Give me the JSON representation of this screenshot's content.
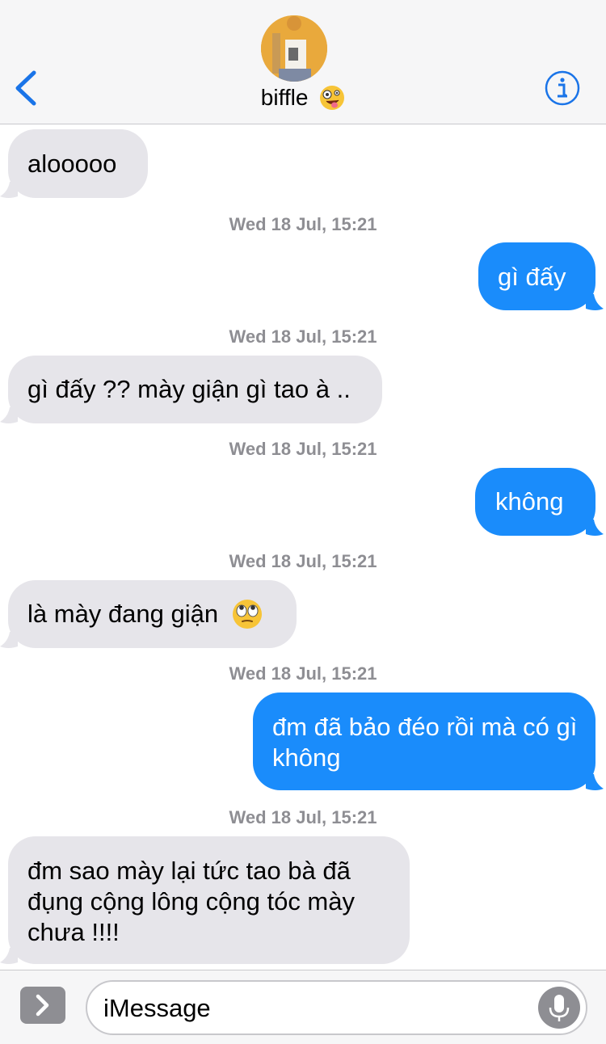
{
  "header": {
    "contact_name": "biffle",
    "back_icon": "chevron-left-icon",
    "info_icon": "info-icon",
    "accent": "#1a74e8"
  },
  "messages": [
    {
      "type": "incoming",
      "text": "alooooo"
    },
    {
      "type": "timestamp",
      "text": "Wed 18 Jul, 15:21"
    },
    {
      "type": "outgoing",
      "text": "gì đấy"
    },
    {
      "type": "timestamp",
      "text": "Wed 18 Jul, 15:21"
    },
    {
      "type": "incoming",
      "text": "gì đấy ?? mày giận gì tao à .."
    },
    {
      "type": "timestamp",
      "text": "Wed 18 Jul, 15:21"
    },
    {
      "type": "outgoing",
      "text": "không"
    },
    {
      "type": "timestamp",
      "text": "Wed 18 Jul, 15:21"
    },
    {
      "type": "incoming",
      "text": "là mày đang giận"
    },
    {
      "type": "timestamp",
      "text": "Wed 18 Jul, 15:21"
    },
    {
      "type": "outgoing",
      "text": "đm đã bảo đéo rồi mà có gì không"
    },
    {
      "type": "timestamp",
      "text": "Wed 18 Jul, 15:21"
    },
    {
      "type": "incoming",
      "text": "đm sao mày lại tức tao bà đã đụng cộng lông cộng tóc mày chưa !!!!"
    }
  ],
  "composer": {
    "placeholder": "iMessage",
    "apps_icon": "chevron-right-icon",
    "mic_icon": "microphone-icon"
  },
  "colors": {
    "incoming_bubble": "#e6e5ea",
    "outgoing_bubble": "#1a8cfb",
    "timestamp": "#8e8e93"
  }
}
